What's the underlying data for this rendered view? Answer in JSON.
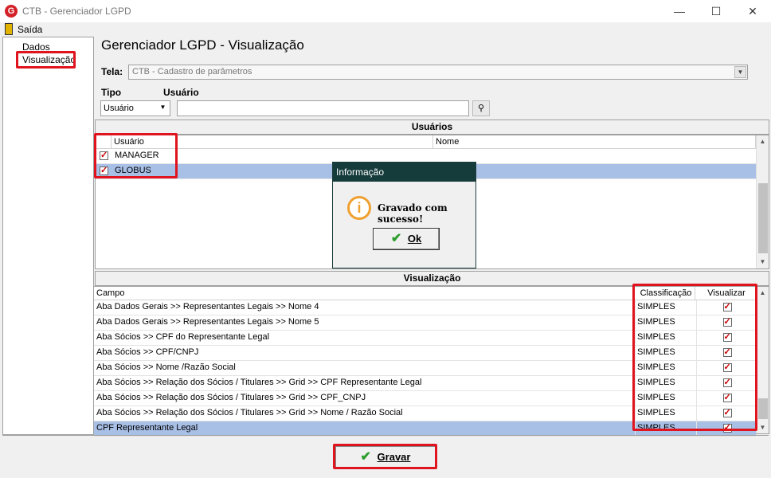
{
  "window": {
    "title": "CTB - Gerenciador LGPD",
    "logo": "G"
  },
  "window_controls": {
    "minimize": "—",
    "maximize": "☐",
    "close": "✕"
  },
  "menu": {
    "exit": "Saída"
  },
  "tree": {
    "items": [
      "Dados",
      "Visualização"
    ],
    "selected": "Visualização"
  },
  "header": {
    "title": "Gerenciador LGPD - Visualização",
    "screen_label": "Tela:",
    "screen_value": "CTB - Cadastro de parâmetros",
    "type_label": "Tipo",
    "type_value": "Usuário",
    "user_label": "Usuário",
    "user_value": ""
  },
  "users_panel": {
    "title": "Usuários",
    "columns": [
      "Usuário",
      "Nome"
    ],
    "rows": [
      {
        "checked": true,
        "user": "MANAGER",
        "name": "",
        "selected": false
      },
      {
        "checked": true,
        "user": "GLOBUS",
        "name": "",
        "selected": true
      }
    ]
  },
  "view_panel": {
    "title": "Visualização",
    "columns": [
      "Campo",
      "Classificação",
      "Visualizar"
    ],
    "rows": [
      {
        "field": "Aba Dados Gerais >> Representantes Legais >> Nome 4",
        "class": "SIMPLES",
        "view": true,
        "selected": false
      },
      {
        "field": "Aba Dados Gerais >> Representantes Legais >> Nome 5",
        "class": "SIMPLES",
        "view": true,
        "selected": false
      },
      {
        "field": "Aba Sócios >> CPF do Representante Legal",
        "class": "SIMPLES",
        "view": true,
        "selected": false
      },
      {
        "field": "Aba Sócios >> CPF/CNPJ",
        "class": "SIMPLES",
        "view": true,
        "selected": false
      },
      {
        "field": "Aba Sócios >> Nome /Razão Social",
        "class": "SIMPLES",
        "view": true,
        "selected": false
      },
      {
        "field": "Aba Sócios >> Relação dos Sócios / Titulares >> Grid >> CPF Representante Legal",
        "class": "SIMPLES",
        "view": true,
        "selected": false
      },
      {
        "field": "Aba Sócios >> Relação dos Sócios / Titulares >> Grid >> CPF_CNPJ",
        "class": "SIMPLES",
        "view": true,
        "selected": false
      },
      {
        "field": "Aba Sócios >> Relação dos Sócios / Titulares >> Grid >> Nome / Razão Social",
        "class": "SIMPLES",
        "view": true,
        "selected": false
      },
      {
        "field": "CPF Representante Legal",
        "class": "SIMPLES",
        "view": true,
        "selected": true
      }
    ]
  },
  "dialog": {
    "title": "Informação",
    "icon": "i",
    "message": "Gravado com sucesso!",
    "ok_label": "Ok"
  },
  "footer": {
    "save_label": "Gravar"
  },
  "colors": {
    "highlight": "#e0141e",
    "selection": "#a8bfe6",
    "dialog_title": "#153b3b"
  }
}
